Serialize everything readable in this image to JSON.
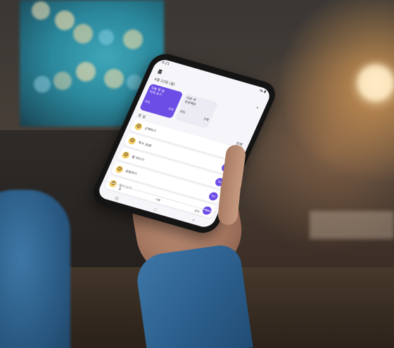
{
  "image": {
    "subject": "hand holding smartphone with purple task app",
    "accent": "#6c4de6",
    "background_glow": "#f0b46a",
    "window_tint": "#2fa4b8",
    "sleeve_color": "#2c5f8d"
  },
  "phone_ui": {
    "status_time": "4:21",
    "status_icons": "▾▴ ▮",
    "app_title": "홈",
    "subheader": "4월 22일 (월)",
    "add_label": "+",
    "cards": [
      {
        "title": "오늘 할 일",
        "subtitle": "미래 보기",
        "left": "0%",
        "right": "5개"
      },
      {
        "title": "이번 주",
        "subtitle": "프로젝트",
        "left": "0%",
        "right": "3개"
      }
    ],
    "section_title": "할 일",
    "section_action": "전체",
    "items": [
      {
        "text": "산책하기",
        "btn": "Go"
      },
      {
        "text": "독서 30분",
        "btn": "Go"
      },
      {
        "text": "물 마시기",
        "btn": "Go"
      },
      {
        "text": "운동하기",
        "btn": "Go"
      },
      {
        "text": "일기 쓰기",
        "btn": "Go"
      }
    ],
    "nav": [
      "홈",
      "기록",
      "설정"
    ],
    "sys_nav": [
      "|||",
      "○",
      "<"
    ]
  }
}
